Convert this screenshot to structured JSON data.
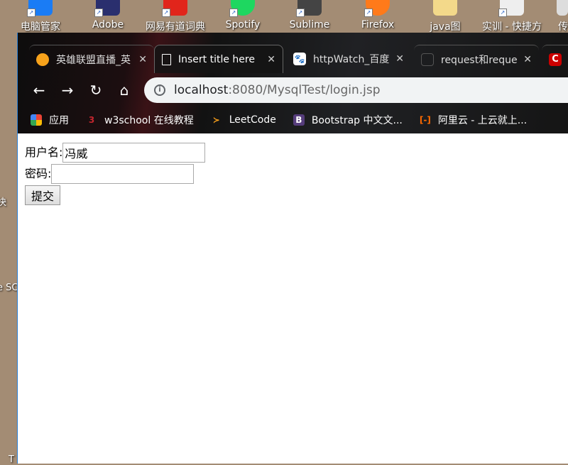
{
  "desktop": {
    "icons": [
      {
        "label": "电脑管家",
        "color": "#1a7cf5"
      },
      {
        "label": "Adobe",
        "color": "#2a2f6e"
      },
      {
        "label": "网易有道词典",
        "color": "#e1251b"
      },
      {
        "label": "Spotify",
        "color": "#1ed760"
      },
      {
        "label": "Sublime",
        "color": "#444"
      },
      {
        "label": "Firefox",
        "color": "#ff7a1a"
      },
      {
        "label": "java图",
        "color": "#f3d98a"
      },
      {
        "label": "实训 - 快捷方",
        "color": "#eee"
      },
      {
        "label": "传",
        "color": "#ddd"
      }
    ],
    "fragments": [
      "快",
      "e SC",
      "T"
    ]
  },
  "tabs": [
    {
      "title": "英雄联盟直播_英",
      "icon": "huya-icon",
      "color": "#f7a21b"
    },
    {
      "title": "Insert title here",
      "icon": "document-icon",
      "active": true
    },
    {
      "title": "httpWatch_百度",
      "icon": "baidu-icon",
      "color": "#2e6bd6"
    },
    {
      "title": "request和request",
      "icon": "site-icon",
      "color": "#555"
    },
    {
      "title": "",
      "icon": "csdn-icon",
      "color": "#c00"
    }
  ],
  "address": {
    "host": "localhost",
    "path": ":8080/MysqlTest/login.jsp"
  },
  "bookmarks": [
    {
      "label": "应用",
      "icon": "apps-icon"
    },
    {
      "label": "w3school 在线教程",
      "icon": "w3school-icon",
      "color": "#c4262e"
    },
    {
      "label": "LeetCode",
      "icon": "leetcode-icon",
      "color": "#f89f1b"
    },
    {
      "label": "Bootstrap 中文文...",
      "icon": "bootstrap-icon",
      "color": "#563d7c"
    },
    {
      "label": "阿里云 - 上云就上...",
      "icon": "aliyun-icon",
      "color": "#ff6a00"
    }
  ],
  "form": {
    "username_label": "用户名:",
    "username_value": "冯威",
    "password_label": "密码:",
    "password_value": "",
    "submit_label": "提交"
  }
}
